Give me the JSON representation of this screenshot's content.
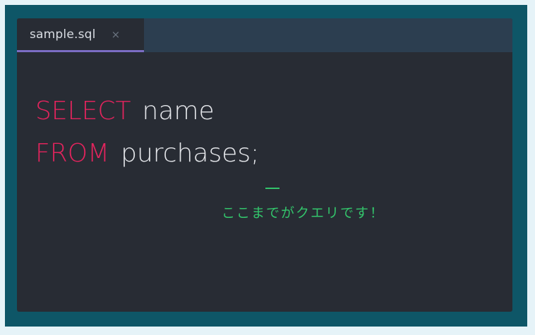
{
  "editor": {
    "tab": {
      "filename": "sample.sql",
      "close_glyph": "×"
    },
    "code": {
      "line1": {
        "keyword": "SELECT",
        "text": "name"
      },
      "line2": {
        "keyword": "FROM",
        "text": "purchases;"
      }
    },
    "annotation": "ここまでがクエリです！"
  },
  "colors": {
    "keyword": "#e2245d",
    "annotation": "#33c46b",
    "tab_accent": "#7b6dc4",
    "frame": "#0e5667"
  }
}
